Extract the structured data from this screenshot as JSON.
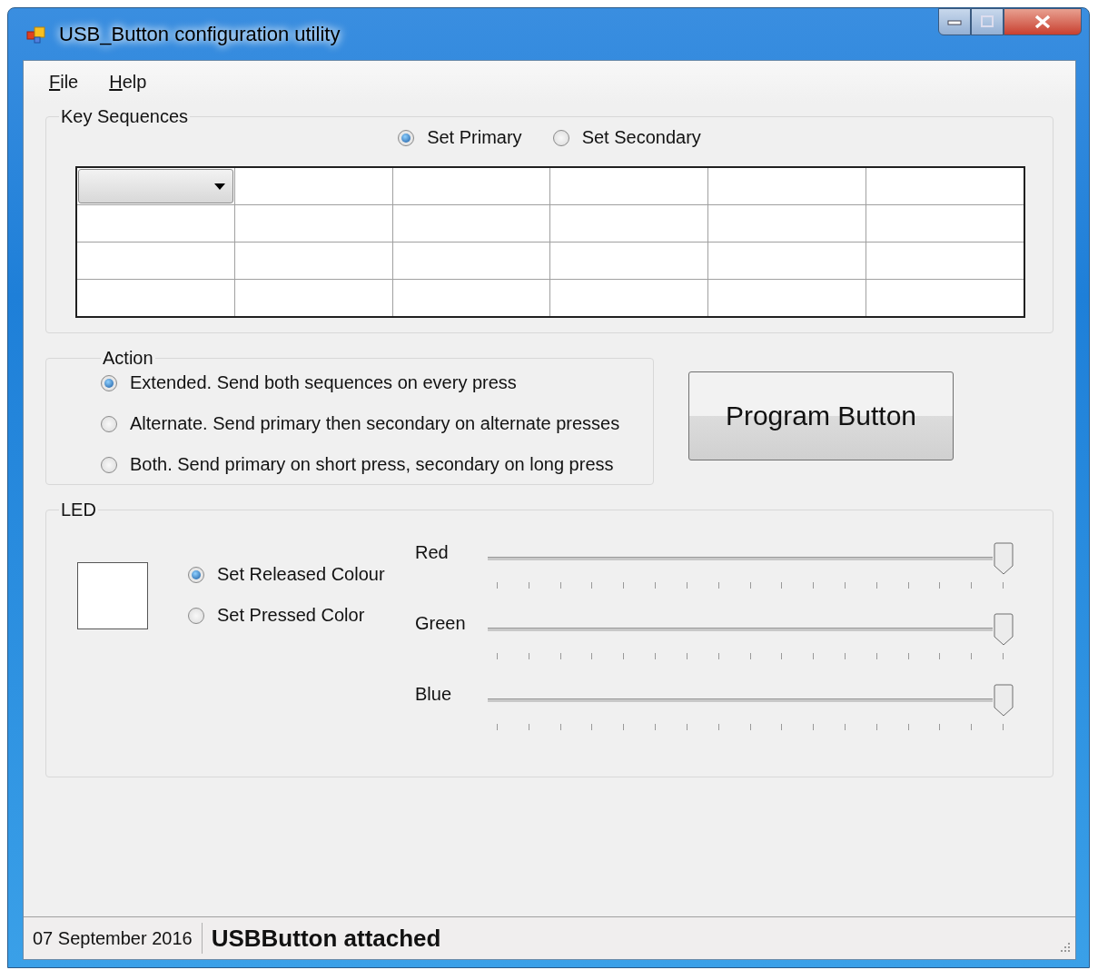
{
  "window": {
    "title": "USB_Button configuration utility"
  },
  "menu": [
    {
      "label": "File"
    },
    {
      "label": "Help"
    }
  ],
  "key_sequences": {
    "title": "Key Sequences",
    "options": [
      {
        "label": "Set Primary",
        "selected": true
      },
      {
        "label": "Set Secondary",
        "selected": false
      }
    ],
    "grid": [
      {
        "cells": [
          {
            "kind": "dropdown"
          },
          {
            "kind": "empty"
          },
          {
            "kind": "empty"
          },
          {
            "kind": "empty"
          },
          {
            "kind": "empty"
          },
          {
            "kind": "empty"
          }
        ]
      },
      {
        "cells": [
          {
            "kind": "empty"
          },
          {
            "kind": "empty"
          },
          {
            "kind": "empty"
          },
          {
            "kind": "empty"
          },
          {
            "kind": "empty"
          },
          {
            "kind": "empty"
          }
        ]
      },
      {
        "cells": [
          {
            "kind": "empty"
          },
          {
            "kind": "empty"
          },
          {
            "kind": "empty"
          },
          {
            "kind": "empty"
          },
          {
            "kind": "empty"
          },
          {
            "kind": "empty"
          }
        ]
      },
      {
        "cells": [
          {
            "kind": "empty"
          },
          {
            "kind": "empty"
          },
          {
            "kind": "empty"
          },
          {
            "kind": "empty"
          },
          {
            "kind": "empty"
          },
          {
            "kind": "empty"
          }
        ]
      }
    ]
  },
  "action": {
    "title": "Action",
    "options": [
      {
        "label": "Extended. Send both sequences on every press",
        "selected": true
      },
      {
        "label": "Alternate. Send primary then secondary on alternate presses",
        "selected": false
      },
      {
        "label": "Both. Send primary on short press, secondary on long press",
        "selected": false
      }
    ]
  },
  "program_button": "Program Button",
  "led": {
    "title": "LED",
    "options": [
      {
        "label": "Set Released Colour",
        "selected": true
      },
      {
        "label": "Set Pressed Color",
        "selected": false
      }
    ],
    "sliders": [
      {
        "label": "Red",
        "level": 1
      },
      {
        "label": "Green",
        "level": 1
      },
      {
        "label": "Blue",
        "level": 1
      }
    ]
  },
  "status_bar": {
    "date": "07 September 2016",
    "message": "USBButton attached"
  }
}
